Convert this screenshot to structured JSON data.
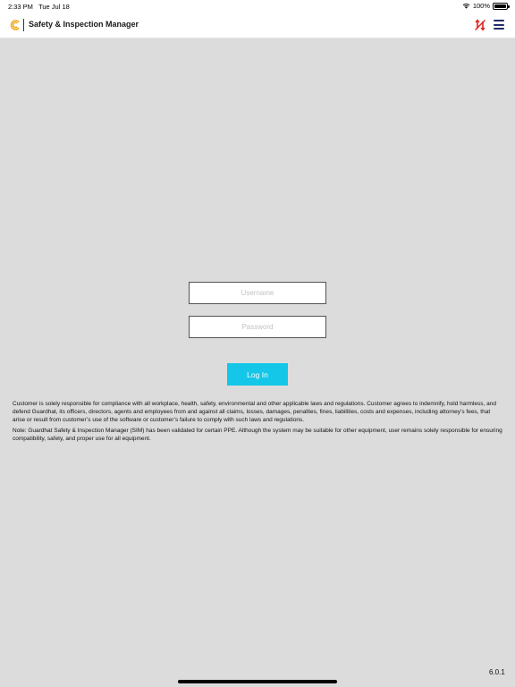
{
  "status_bar": {
    "time": "2:33 PM",
    "date": "Tue Jul 18",
    "battery": "100%",
    "battery_level": 1.0,
    "icons": [
      "wifi-icon",
      "battery-icon"
    ]
  },
  "header": {
    "title": "Safety & Inspection Manager",
    "logo_color": "#f0a81e",
    "icons": [
      "logo-icon",
      "offline-sync-icon",
      "menu-icon"
    ],
    "offline_icon_color": "#e02020",
    "menu_icon_color": "#1f2b6b"
  },
  "login": {
    "username_placeholder": "Username",
    "username_value": "",
    "password_placeholder": "Password",
    "password_value": "",
    "login_label": "Log In",
    "button_color": "#14c6e8"
  },
  "disclaimer": {
    "paragraph1": "Customer is solely responsible for compliance with all workplace, health, safety, environmental and other applicable laws and regulations.  Customer agrees to indemnify, hold harmless, and defend Guardhat, its officers, directors, agents and employees from and against all claims, losses, damages, penalties, fines, liabilities, costs and expenses, including attorney’s fees, that arise or result from customer’s use of the software or customer’s failure to comply with such laws and regulations.",
    "paragraph2": "Note: Guardhat Safety & Inspection Manager (SIM) has been validated for certain PPE. Although the system may be suitable for other equipment, user remains solely responsible for ensuring compatibility, safety, and proper use for all equipment."
  },
  "version": "6.0.1",
  "colors": {
    "background": "#dcdcdc",
    "header_background": "#ffffff"
  }
}
